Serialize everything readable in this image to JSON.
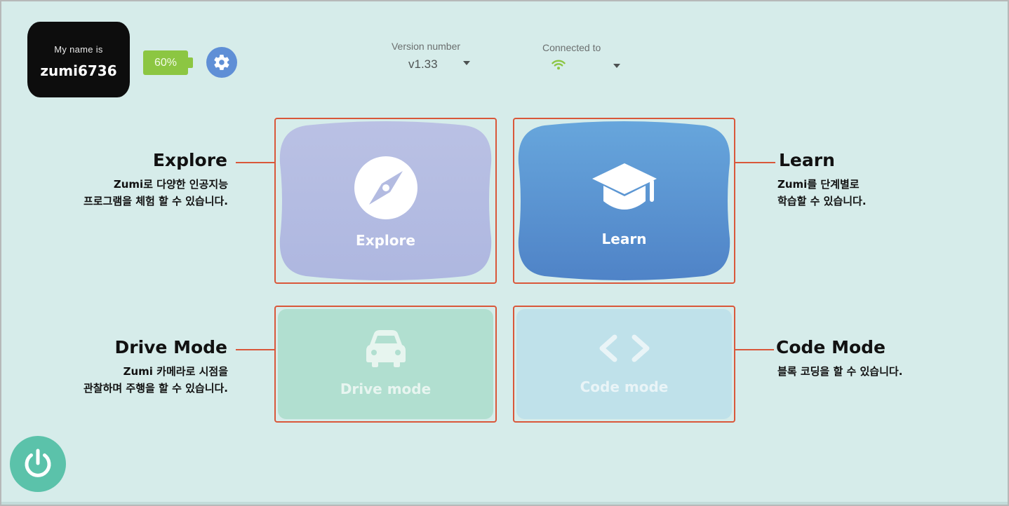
{
  "header": {
    "name_caption": "My name is",
    "robot_name": "zumi6736",
    "battery_label": "60%",
    "battery_level_percent": 60,
    "settings_icon": "gear-icon",
    "version": {
      "caption": "Version number",
      "value": "v1.33"
    },
    "connection": {
      "caption": "Connected to",
      "icon": "wifi-icon"
    }
  },
  "cards": {
    "explore": {
      "label": "Explore",
      "icon": "compass-icon",
      "color": "#b7bfe3"
    },
    "learn": {
      "label": "Learn",
      "icon": "graduation-cap-icon",
      "color": "#5b93d3"
    },
    "drive": {
      "label": "Drive mode",
      "icon": "car-icon",
      "color": "#b1dfd0"
    },
    "code": {
      "label": "Code mode",
      "icon": "code-brackets-icon",
      "color": "#bfe1ea"
    }
  },
  "annotations": {
    "explore": {
      "title": "Explore",
      "lines": [
        "Zumi로 다양한 인공지능",
        "프로그램을 체험 할 수 있습니다."
      ]
    },
    "learn": {
      "title": "Learn",
      "lines": [
        "Zumi를 단계별로",
        "학습할 수 있습니다."
      ]
    },
    "drive": {
      "title": "Drive Mode",
      "lines": [
        "Zumi 카메라로 시점을",
        "관찰하며 주행을 할 수 있습니다."
      ]
    },
    "code": {
      "title": "Code Mode",
      "lines": [
        "블록 코딩을 할 수 있습니다."
      ]
    }
  },
  "power": {
    "icon": "power-icon"
  },
  "colors": {
    "background": "#d6ecea",
    "highlight": "#d9573a",
    "battery": "#8cc642",
    "settings": "#5f8fd6",
    "power": "#5bc2aa",
    "wifi": "#8cc642"
  }
}
